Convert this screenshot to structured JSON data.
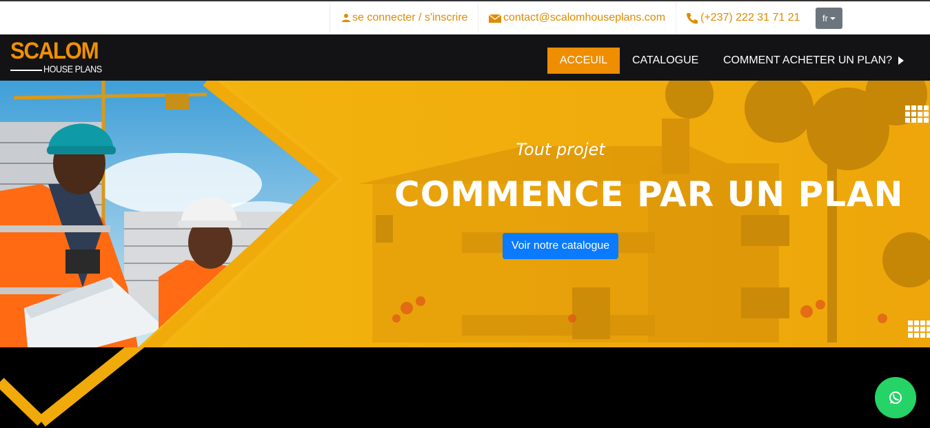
{
  "topbar": {
    "login_label": "se connecter / s'inscrire",
    "email": "contact@scalomhouseplans.com",
    "phone": "(+237) 222 31 71 21",
    "language": "fr"
  },
  "logo": {
    "main": "SCALOM",
    "sub": "HOUSE PLANS"
  },
  "nav": {
    "items": [
      {
        "label": "ACCEUIL",
        "active": true
      },
      {
        "label": "CATALOGUE",
        "active": false
      },
      {
        "label": "COMMENT ACHETER UN PLAN?",
        "active": false
      }
    ]
  },
  "hero": {
    "subtitle": "Tout projet",
    "title": "COMMENCE PAR UN PLAN",
    "cta_label": "Voir notre catalogue"
  },
  "colors": {
    "brand_orange": "#ee8e00",
    "hero_yellow": "#f0ae0c",
    "cta_blue": "#0a7bff",
    "whatsapp_green": "#25d366",
    "nav_bg": "#131316"
  },
  "icons": {
    "login": "user-icon",
    "email": "envelope-icon",
    "phone": "phone-icon",
    "whatsapp": "whatsapp-icon"
  }
}
